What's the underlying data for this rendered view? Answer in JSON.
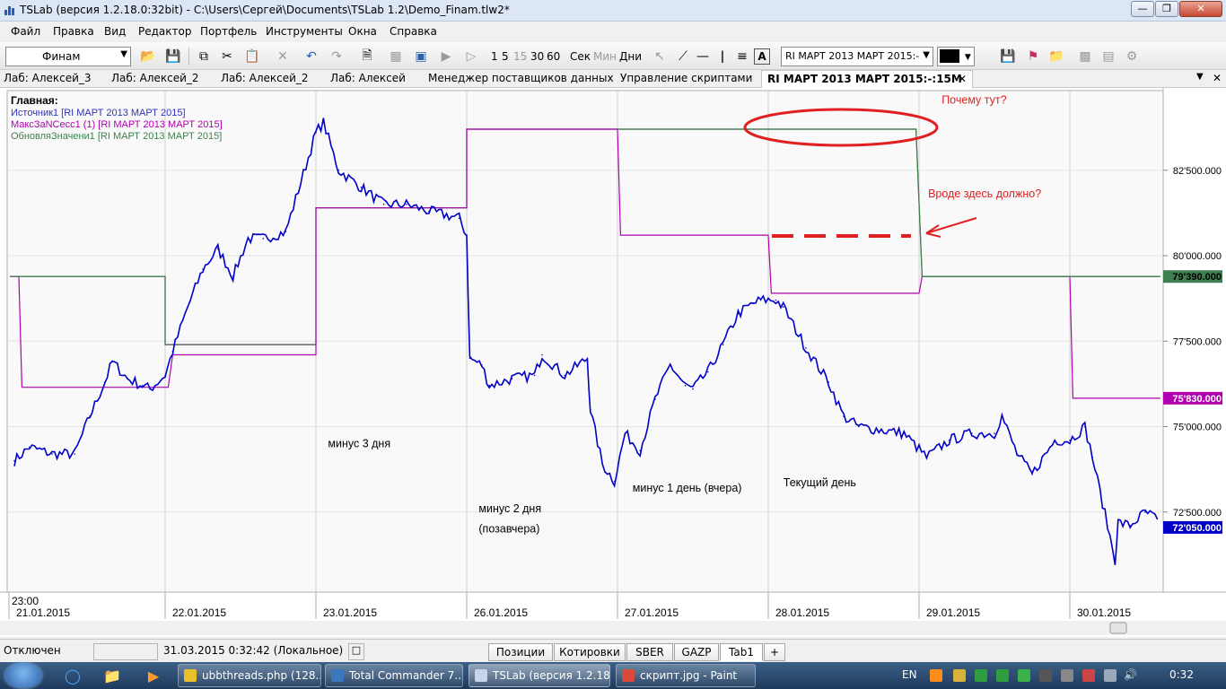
{
  "window": {
    "title": "TSLab (версия 1.2.18.0:32bit) - C:\\Users\\Сергей\\Documents\\TSLab 1.2\\Demo_Finam.tlw2*"
  },
  "menu": [
    "Файл",
    "Правка",
    "Вид",
    "Редактор",
    "Портфель",
    "Инструменты",
    "Окна",
    "Справка"
  ],
  "toolbar": {
    "provider_label": "Финам",
    "intervals": [
      "1",
      "5",
      "15",
      "30",
      "60"
    ],
    "units": [
      "Сек",
      "Мин",
      "Дни"
    ],
    "symbol_select": "RI МАРТ 2013 МАРТ 2015:-",
    "color_select": "#000000"
  },
  "tabs": [
    {
      "label": "Лаб: Алексей_3"
    },
    {
      "label": "Лаб: Алексей_2"
    },
    {
      "label": "Лаб: Алексей_2"
    },
    {
      "label": "Лаб: Алексей"
    },
    {
      "label": "Менеджер поставщиков данных"
    },
    {
      "label": "Управление скриптами"
    },
    {
      "label": "RI МАРТ 2013 МАРТ 2015:-:15M",
      "active": true
    }
  ],
  "colors": {
    "price": "#0000c8",
    "max": "#b000b0",
    "upd": "#3f7f4f",
    "annot": "#e02020"
  },
  "chart_data": {
    "type": "line",
    "pane_title": "Главная:",
    "legend": [
      {
        "name": "Источник1 [RI МАРТ 2013 МАРТ 2015]",
        "color": "#3030c0"
      },
      {
        "name": "МаксЗаNСесс1 (1) [RI МАРТ 2013 МАРТ 2015]",
        "color": "#b000b0"
      },
      {
        "name": "ОбновляЗначени1 [RI МАРТ 2013 МАРТ 2015]",
        "color": "#3f7f4f"
      }
    ],
    "ylim": [
      70250,
      84250
    ],
    "y_ticks": [
      "82'500.000",
      "80'000.000",
      "77'500.000",
      "75'000.000",
      "72'500.000"
    ],
    "y_tick_values": [
      82500,
      80000,
      77500,
      75000,
      72500
    ],
    "x_start_time": "23:00",
    "x_ticks": [
      "21.01.2015",
      "22.01.2015",
      "23.01.2015",
      "26.01.2015",
      "27.01.2015",
      "28.01.2015",
      "29.01.2015",
      "30.01.2015"
    ],
    "day_range": [
      -0.03,
      7.6
    ],
    "price_series": {
      "name": "Источник1",
      "points": [
        [
          0,
          74000
        ],
        [
          0.1,
          74400
        ],
        [
          0.25,
          74200
        ],
        [
          0.4,
          74200
        ],
        [
          0.5,
          75300
        ],
        [
          0.6,
          76300
        ],
        [
          0.65,
          76900
        ],
        [
          0.75,
          76400
        ],
        [
          0.85,
          76200
        ],
        [
          0.9,
          76100
        ],
        [
          1,
          76500
        ],
        [
          1.05,
          77200
        ],
        [
          1.15,
          78500
        ],
        [
          1.25,
          79600
        ],
        [
          1.35,
          80200
        ],
        [
          1.45,
          79400
        ],
        [
          1.55,
          80500
        ],
        [
          1.65,
          80500
        ],
        [
          1.8,
          80700
        ],
        [
          2,
          83600
        ],
        [
          2.05,
          83900
        ],
        [
          2.15,
          82500
        ],
        [
          2.3,
          82000
        ],
        [
          2.45,
          81500
        ],
        [
          2.6,
          81500
        ],
        [
          2.75,
          81300
        ],
        [
          2.95,
          81100
        ],
        [
          3,
          80600
        ],
        [
          3.02,
          77000
        ],
        [
          3.1,
          76800
        ],
        [
          3.15,
          76200
        ],
        [
          3.3,
          76400
        ],
        [
          3.45,
          76500
        ],
        [
          3.5,
          77100
        ],
        [
          3.65,
          76500
        ],
        [
          3.8,
          77000
        ],
        [
          3.82,
          75500
        ],
        [
          3.9,
          73900
        ],
        [
          3.98,
          73400
        ],
        [
          4.05,
          74800
        ],
        [
          4.15,
          74300
        ],
        [
          4.25,
          75800
        ],
        [
          4.35,
          76800
        ],
        [
          4.45,
          76200
        ],
        [
          4.5,
          76100
        ],
        [
          4.6,
          76600
        ],
        [
          4.7,
          77400
        ],
        [
          4.8,
          78300
        ],
        [
          4.9,
          78600
        ],
        [
          4.95,
          78700
        ],
        [
          5.05,
          78700
        ],
        [
          5.1,
          78500
        ],
        [
          5.25,
          77300
        ],
        [
          5.4,
          76300
        ],
        [
          5.5,
          75300
        ],
        [
          5.6,
          75000
        ],
        [
          5.75,
          74900
        ],
        [
          5.9,
          74800
        ],
        [
          6.05,
          74100
        ],
        [
          6.2,
          74600
        ],
        [
          6.35,
          74800
        ],
        [
          6.5,
          74800
        ],
        [
          6.55,
          75300
        ],
        [
          6.65,
          74200
        ],
        [
          6.75,
          73600
        ],
        [
          6.9,
          74600
        ],
        [
          7,
          74600
        ],
        [
          7.1,
          75000
        ],
        [
          7.15,
          74100
        ],
        [
          7.25,
          72100
        ],
        [
          7.3,
          71100
        ],
        [
          7.32,
          72200
        ],
        [
          7.4,
          72100
        ],
        [
          7.5,
          72500
        ],
        [
          7.58,
          72300
        ]
      ]
    },
    "max_series": {
      "name": "МаксЗаNСесс1",
      "steps": [
        [
          -0.03,
          79390
        ],
        [
          0.03,
          79390
        ],
        [
          0.05,
          76150
        ],
        [
          1.02,
          76150
        ],
        [
          1.05,
          77100
        ],
        [
          2.0,
          77100
        ],
        [
          2.0,
          81400
        ],
        [
          3.0,
          81400
        ],
        [
          3.0,
          83700
        ],
        [
          4.0,
          83700
        ],
        [
          4.02,
          80600
        ],
        [
          5.0,
          80600
        ],
        [
          5.02,
          78900
        ],
        [
          6.0,
          78900
        ],
        [
          6.02,
          79390
        ],
        [
          7.0,
          79390
        ],
        [
          7.02,
          75830
        ],
        [
          7.6,
          75830
        ]
      ]
    },
    "update_series": {
      "name": "ОбновляЗначени1",
      "steps": [
        [
          -0.03,
          79390
        ],
        [
          1.0,
          79390
        ],
        [
          1.0,
          77400
        ],
        [
          2.0,
          77400
        ],
        [
          2.0,
          81400
        ],
        [
          3.0,
          81400
        ],
        [
          3.0,
          83700
        ],
        [
          5.98,
          83700
        ],
        [
          6.02,
          79390
        ],
        [
          7.6,
          79390
        ]
      ]
    },
    "last_values": [
      {
        "label": "79'390.000",
        "value": 79390,
        "color": "#3f7f4f",
        "text_color": "#000000"
      },
      {
        "label": "75'830.000",
        "value": 75830,
        "color": "#b000b0",
        "text_color": "#ffffff"
      },
      {
        "label": "72'050.000",
        "value": 72050,
        "color": "#0000c8",
        "text_color": "#ffffff"
      }
    ],
    "annotations": [
      {
        "text": "минус 3 дня",
        "day": 2.08,
        "value": 74400,
        "color": "#000000"
      },
      {
        "text": "минус 2 дня",
        "day": 3.08,
        "value": 72500,
        "color": "#000000"
      },
      {
        "text": "(позавчера)",
        "day": 3.08,
        "value": 71900,
        "color": "#000000"
      },
      {
        "text": "минус 1 день (вчера)",
        "day": 4.1,
        "value": 73100,
        "color": "#000000"
      },
      {
        "text": "Текущий день",
        "day": 5.1,
        "value": 73250,
        "color": "#000000"
      },
      {
        "text": "Почему тут?",
        "day": 6.15,
        "value": 84450,
        "color": "#e02020"
      },
      {
        "text": "Вроде здесь должно?",
        "day": 6.06,
        "value": 81700,
        "color": "#e02020"
      }
    ]
  },
  "status": {
    "connection": "Отключен",
    "datetime": "31.03.2015 0:32:42 (Локальное)",
    "bottom_tabs": [
      "Позиции",
      "Котировки",
      "SBER",
      "GAZP",
      "Tab1",
      "+"
    ],
    "active_tab": "Tab1"
  },
  "taskbar": {
    "items": [
      {
        "label": "ubbthreads.php (128...",
        "color": "#e8c02a"
      },
      {
        "label": "Total Commander 7....",
        "color": "#3a78c0"
      },
      {
        "label": "TSLab (версия 1.2.18...",
        "color": "#c8d4e8"
      },
      {
        "label": "скрипт.jpg - Paint",
        "color": "#d94a3a"
      }
    ],
    "lang": "EN",
    "clock": "0:32"
  }
}
